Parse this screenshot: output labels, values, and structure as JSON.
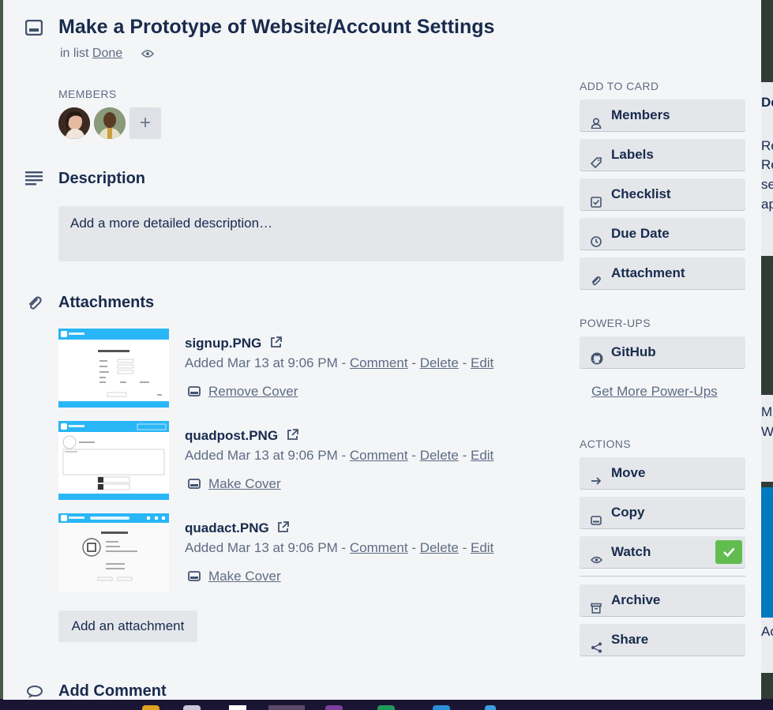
{
  "card": {
    "title": "Make a Prototype of Website/Account Settings",
    "in_list_prefix": "in list",
    "list_name": "Done"
  },
  "members": {
    "label": "MEMBERS",
    "add": "+"
  },
  "description": {
    "title": "Description",
    "placeholder": "Add a more detailed description…"
  },
  "attachments": {
    "title": "Attachments",
    "items": [
      {
        "name": "signup.PNG",
        "added": "Added Mar 13 at 9:06 PM",
        "sep1": "-",
        "comment": "Comment",
        "sep2": "-",
        "delete": "Delete",
        "sep3": "-",
        "edit": "Edit",
        "cover_action": "Remove Cover"
      },
      {
        "name": "quadpost.PNG",
        "added": "Added Mar 13 at 9:06 PM",
        "sep1": "-",
        "comment": "Comment",
        "sep2": "-",
        "delete": "Delete",
        "sep3": "-",
        "edit": "Edit",
        "cover_action": "Make Cover"
      },
      {
        "name": "quadact.PNG",
        "added": "Added Mar 13 at 9:06 PM",
        "sep1": "-",
        "comment": "Comment",
        "sep2": "-",
        "delete": "Delete",
        "sep3": "-",
        "edit": "Edit",
        "cover_action": "Make Cover"
      }
    ],
    "add_button": "Add an attachment"
  },
  "comment": {
    "title": "Add Comment"
  },
  "sidebar": {
    "add_to_card_label": "ADD TO CARD",
    "add_to_card": [
      "Members",
      "Labels",
      "Checklist",
      "Due Date",
      "Attachment"
    ],
    "powerups_label": "POWER-UPS",
    "powerups": [
      "GitHub"
    ],
    "get_more": "Get More Power-Ups",
    "actions_label": "ACTIONS",
    "actions": [
      "Move",
      "Copy",
      "Watch",
      "Archive",
      "Share"
    ]
  },
  "background": {
    "right_texts": [
      "De",
      "Re",
      "Re",
      "se",
      "ap",
      "M",
      "W",
      "Ac"
    ]
  },
  "colors": {
    "watch_check": "#61bd4f",
    "thumb_header": "#29b6f6",
    "dialog_bg": "#f4f5f7"
  }
}
